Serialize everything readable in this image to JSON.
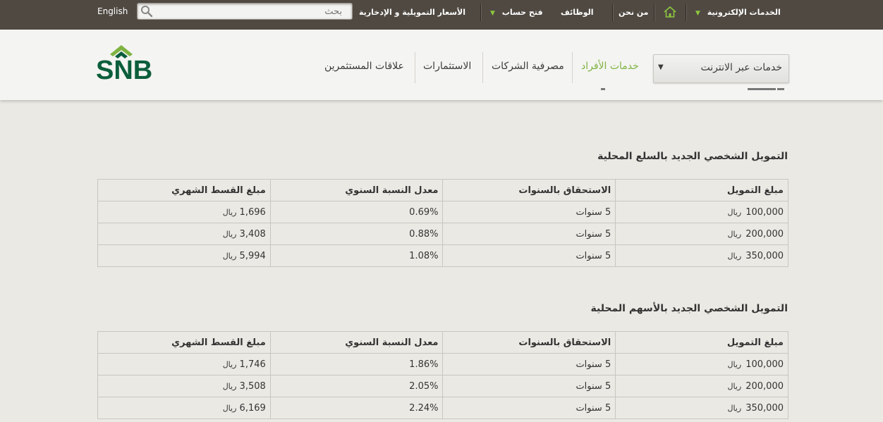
{
  "topbar": {
    "english": "English",
    "search_placeholder": "بحث",
    "items": [
      {
        "label": "الخدمات الإلكترونية"
      },
      {
        "label": "من نحن"
      },
      {
        "label": "الوظائف"
      },
      {
        "label": "فتح حساب"
      },
      {
        "label": "الأسعار التمويلية و الإدخارية"
      }
    ]
  },
  "header": {
    "logo_text": "SNB",
    "nav": [
      {
        "label": "خدمات الأفراد"
      },
      {
        "label": "مصرفية الشركات"
      },
      {
        "label": "الاستثمارات"
      },
      {
        "label": "علاقات المستثمرين"
      }
    ],
    "online_services": "خدمات عبر الانترنت"
  },
  "colors": {
    "topbar_bg": "#4f4942",
    "accent_green": "#7fb341",
    "logo_green": "#0b5e3b",
    "page_bg": "#ebe9e4"
  },
  "tables": [
    {
      "title": "التمويل الشخصي الجديد بالسلع المحلية",
      "headers": [
        "مبلغ التمويل",
        "الاستحقاق بالسنوات",
        "معدل النسبة السنوي",
        "مبلغ القسط الشهري"
      ],
      "rows": [
        {
          "amount": "100,000",
          "currency": "ريال",
          "term": "5 سنوات",
          "rate": "0.69%",
          "installment": "1,696",
          "inst_currency": "ريال"
        },
        {
          "amount": "200,000",
          "currency": "ريال",
          "term": "5 سنوات",
          "rate": "0.88%",
          "installment": "3,408",
          "inst_currency": "ريال"
        },
        {
          "amount": "350,000",
          "currency": "ريال",
          "term": "5 سنوات",
          "rate": "1.08%",
          "installment": "5,994",
          "inst_currency": "ريال"
        }
      ]
    },
    {
      "title": "التمويل الشخصي الجديد بالأسهم المحلية",
      "headers": [
        "مبلغ التمويل",
        "الاستحقاق بالسنوات",
        "معدل النسبة السنوي",
        "مبلغ القسط الشهري"
      ],
      "rows": [
        {
          "amount": "100,000",
          "currency": "ريال",
          "term": "5 سنوات",
          "rate": "1.86%",
          "installment": "1,746",
          "inst_currency": "ريال"
        },
        {
          "amount": "200,000",
          "currency": "ريال",
          "term": "5 سنوات",
          "rate": "2.05%",
          "installment": "3,508",
          "inst_currency": "ريال"
        },
        {
          "amount": "350,000",
          "currency": "ريال",
          "term": "5 سنوات",
          "rate": "2.24%",
          "installment": "6,169",
          "inst_currency": "ريال"
        }
      ]
    }
  ]
}
